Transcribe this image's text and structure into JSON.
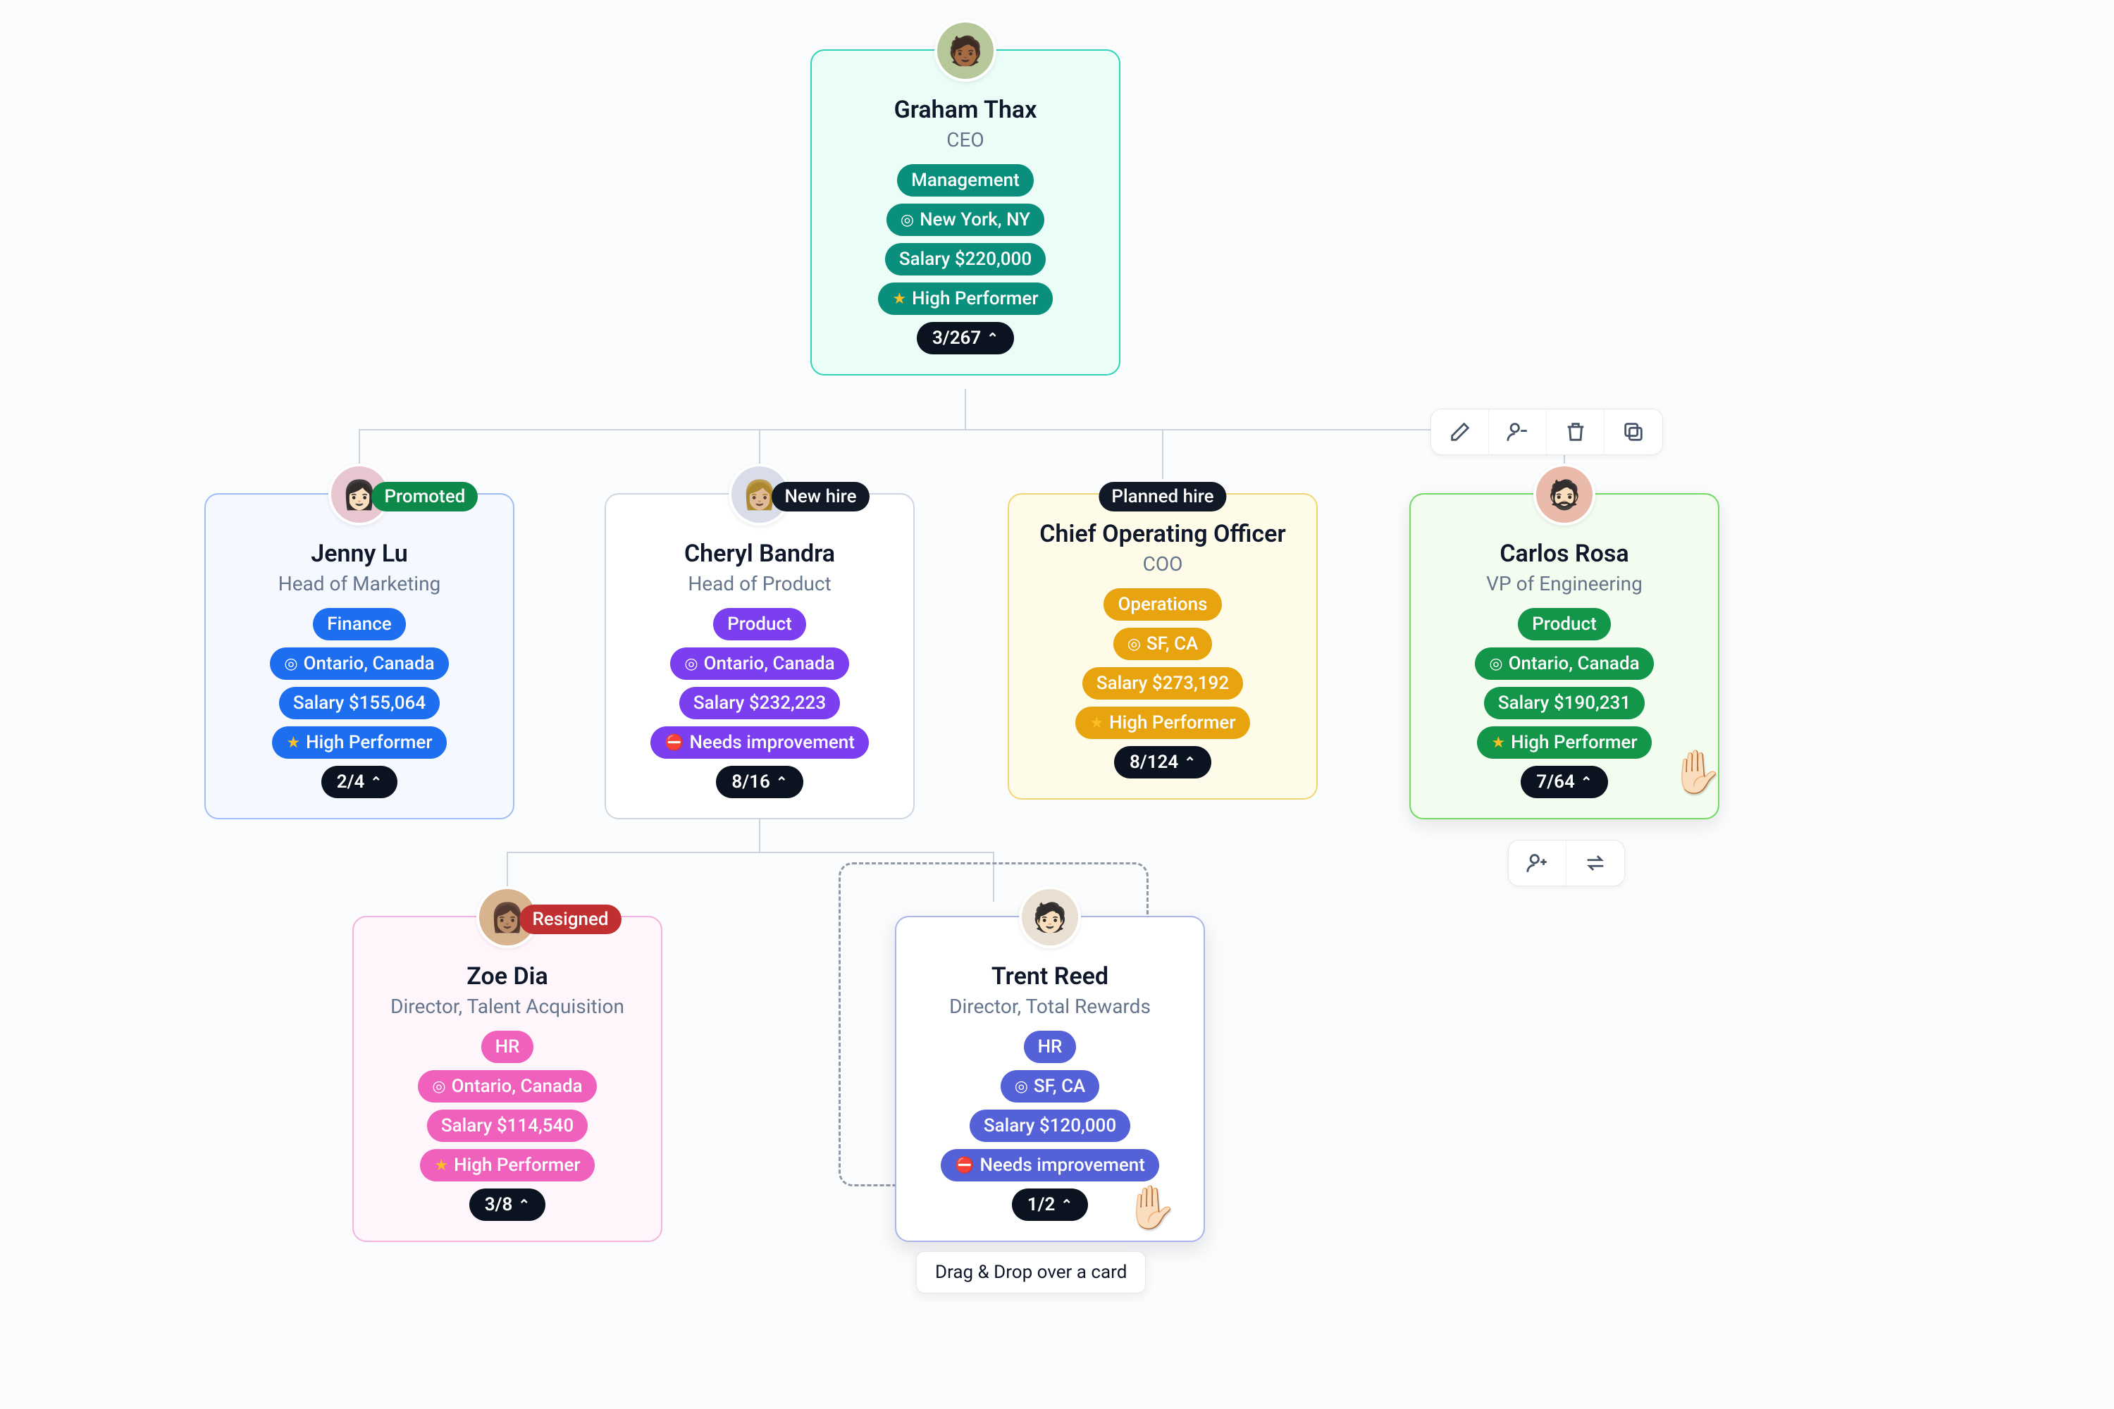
{
  "root": {
    "name": "Graham Thax",
    "role": "CEO",
    "department": "Management",
    "location": "New York, NY",
    "salary": "Salary $220,000",
    "perf": "High Performer",
    "count": "3/267",
    "avatar_bg": "#b6c89a"
  },
  "row2": {
    "jenny": {
      "status": "Promoted",
      "status_bg": "#0d8a4a",
      "name": "Jenny Lu",
      "role": "Head of Marketing",
      "department": "Finance",
      "location": "Ontario, Canada",
      "salary": "Salary $155,064",
      "perf": "High Performer",
      "count": "2/4",
      "avatar_bg": "#e8c6cf"
    },
    "cheryl": {
      "status": "New hire",
      "status_bg": "#111826",
      "name": "Cheryl Bandra",
      "role": "Head of Product",
      "department": "Product",
      "location": "Ontario, Canada",
      "salary": "Salary $232,223",
      "perf": "Needs improvement",
      "count": "8/16",
      "avatar_bg": "#d8dde9"
    },
    "coo": {
      "status": "Planned hire",
      "status_bg": "#111826",
      "name": "Chief Operating Officer",
      "role": "COO",
      "department": "Operations",
      "location": "SF, CA",
      "salary": "Salary $273,192",
      "perf": "High Performer",
      "count": "8/124"
    },
    "carlos": {
      "name": "Carlos Rosa",
      "role": "VP of Engineering",
      "department": "Product",
      "location": "Ontario, Canada",
      "salary": "Salary $190,231",
      "perf": "High Performer",
      "count": "7/64",
      "avatar_bg": "#e9b9a9"
    }
  },
  "row3": {
    "zoe": {
      "status": "Resigned",
      "status_bg": "#c13030",
      "name": "Zoe Dia",
      "role": "Director, Talent Acquisition",
      "department": "HR",
      "location": "Ontario, Canada",
      "salary": "Salary $114,540",
      "perf": "High Performer",
      "count": "3/8",
      "avatar_bg": "#d7b38e"
    },
    "trent": {
      "name": "Trent Reed",
      "role": "Director, Total Rewards",
      "department": "HR",
      "location": "SF, CA",
      "salary": "Salary $120,000",
      "perf": "Needs improvement",
      "count": "1/2",
      "avatar_bg": "#e9dfd2"
    }
  },
  "tooltip": "Drag & Drop over a card",
  "colors": {
    "teal": "#0b8f7d",
    "blue": "#1d6ff0",
    "purple": "#7b3ff0",
    "amber": "#e7a40f",
    "green": "#13954a",
    "pink": "#ef61bd",
    "indigo": "#5561d6"
  },
  "cards_style": {
    "root": {
      "border": "#2fd3b7",
      "bg": "#eafdf7"
    },
    "jenny": {
      "border": "#9fbdf8",
      "bg": "#f5f8ff"
    },
    "cheryl": {
      "border": "#cfd6e3",
      "bg": "#ffffff"
    },
    "coo": {
      "border": "#f2d573",
      "bg": "#fffbe9"
    },
    "carlos": {
      "border": "#72d962",
      "bg": "#f3fdef"
    },
    "zoe": {
      "border": "#f3b3e0",
      "bg": "#fff6fc"
    },
    "trent": {
      "border": "#aab6ea",
      "bg": "#ffffff"
    }
  }
}
